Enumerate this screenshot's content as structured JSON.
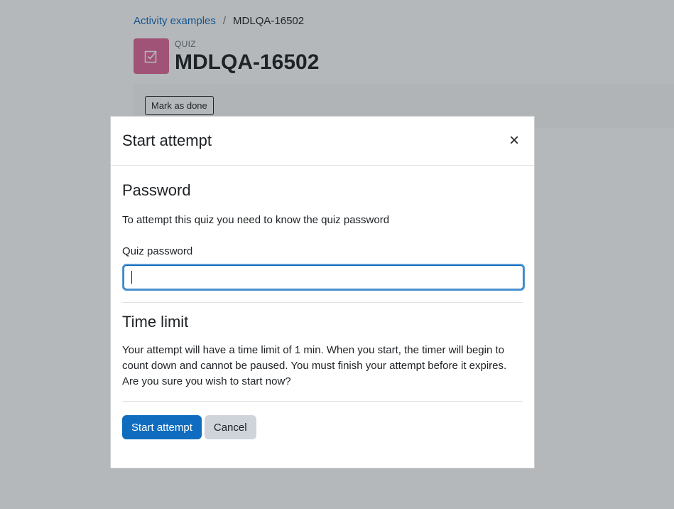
{
  "breadcrumb": {
    "parent": "Activity examples",
    "separator": "/",
    "current": "MDLQA-16502"
  },
  "activity": {
    "type_label": "QUIZ",
    "title": "MDLQA-16502",
    "icon": "quiz-checkbox-icon",
    "icon_color": "#e1689b"
  },
  "completion": {
    "mark_done_label": "Mark as done"
  },
  "modal": {
    "title": "Start attempt",
    "close_icon": "close-icon",
    "password_section": {
      "heading": "Password",
      "description": "To attempt this quiz you need to know the quiz password",
      "field_label": "Quiz password",
      "field_value": ""
    },
    "time_limit_section": {
      "heading": "Time limit",
      "description": "Your attempt will have a time limit of 1 min. When you start, the timer will begin to count down and cannot be paused. You must finish your attempt before it expires. Are you sure you wish to start now?"
    },
    "buttons": {
      "start_label": "Start attempt",
      "cancel_label": "Cancel"
    }
  },
  "colors": {
    "accent": "#0f6cbf",
    "focus_ring": "#5b9bd5",
    "secondary_button": "#ced4da"
  }
}
